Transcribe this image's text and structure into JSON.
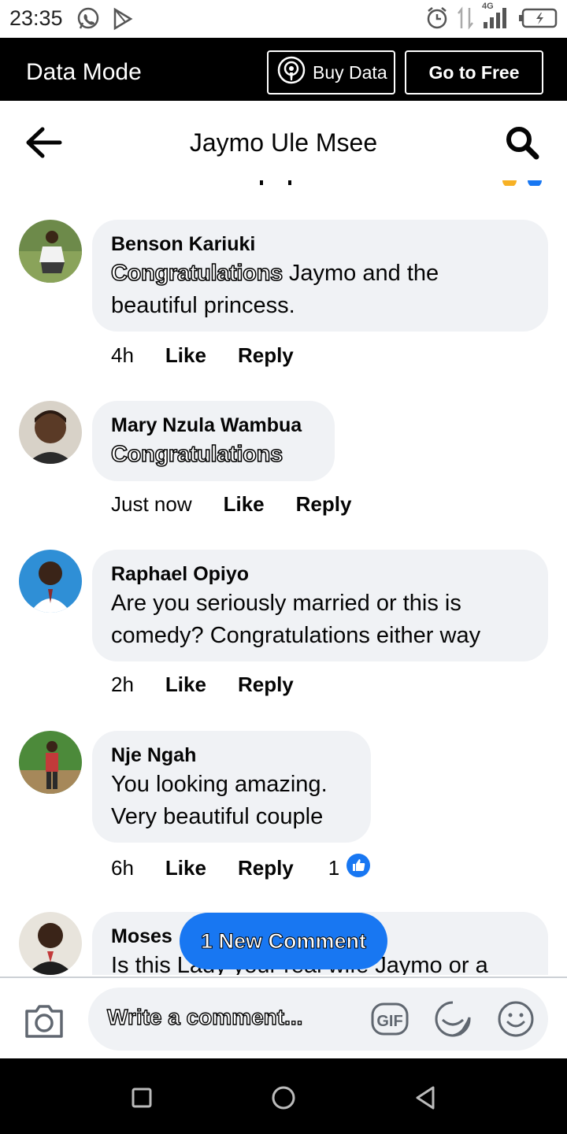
{
  "status_bar": {
    "time": "23:35",
    "network": "4G"
  },
  "data_bar": {
    "title": "Data Mode",
    "buy_label": "Buy Data",
    "free_label": "Go to Free"
  },
  "header": {
    "title": "Jaymo Ule Msee"
  },
  "comments": [
    {
      "author": "Benson Kariuki",
      "highlight": "Congratulations",
      "text": " Jaymo and the beautiful princess.",
      "time": "4h",
      "like_label": "Like",
      "reply_label": "Reply"
    },
    {
      "author": "Mary Nzula Wambua",
      "highlight": "Congratulations",
      "text": "",
      "time": "Just now",
      "like_label": "Like",
      "reply_label": "Reply"
    },
    {
      "author": "Raphael Opiyo",
      "text": "Are you seriously married or this is comedy? Congratulations either way",
      "time": "2h",
      "like_label": "Like",
      "reply_label": "Reply"
    },
    {
      "author": "Nje Ngah",
      "text": "You looking amazing. Very beautiful couple",
      "time": "6h",
      "like_label": "Like",
      "reply_label": "Reply",
      "reactions": "1"
    },
    {
      "author": "Moses",
      "text": "Is this Lady your real wife Jaymo or a"
    }
  ],
  "new_comment_pill": "1 New Comment",
  "composer": {
    "placeholder": "Write a comment..."
  },
  "colors": {
    "accent": "#1877f2",
    "bubble": "#f0f2f5",
    "bar": "#000000"
  }
}
